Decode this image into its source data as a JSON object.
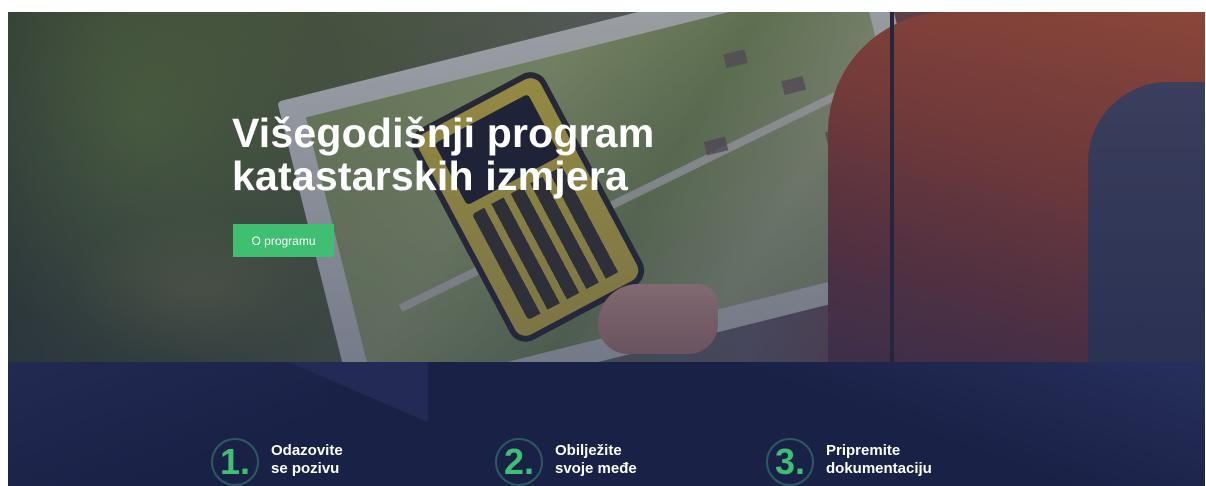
{
  "hero": {
    "title": "Višegodišnji program\nkatastarskih izmjera",
    "button_label": "O programu"
  },
  "steps": [
    {
      "number": "1.",
      "text": "Odazovite\nse pozivu"
    },
    {
      "number": "2.",
      "text": "Obilježite\nsvoje međe"
    },
    {
      "number": "3.",
      "text": "Pripremite\ndokumentaciju"
    }
  ],
  "colors": {
    "accent_green": "#3fbf72",
    "band_navy": "#1a2147",
    "text_white": "#ffffff"
  }
}
